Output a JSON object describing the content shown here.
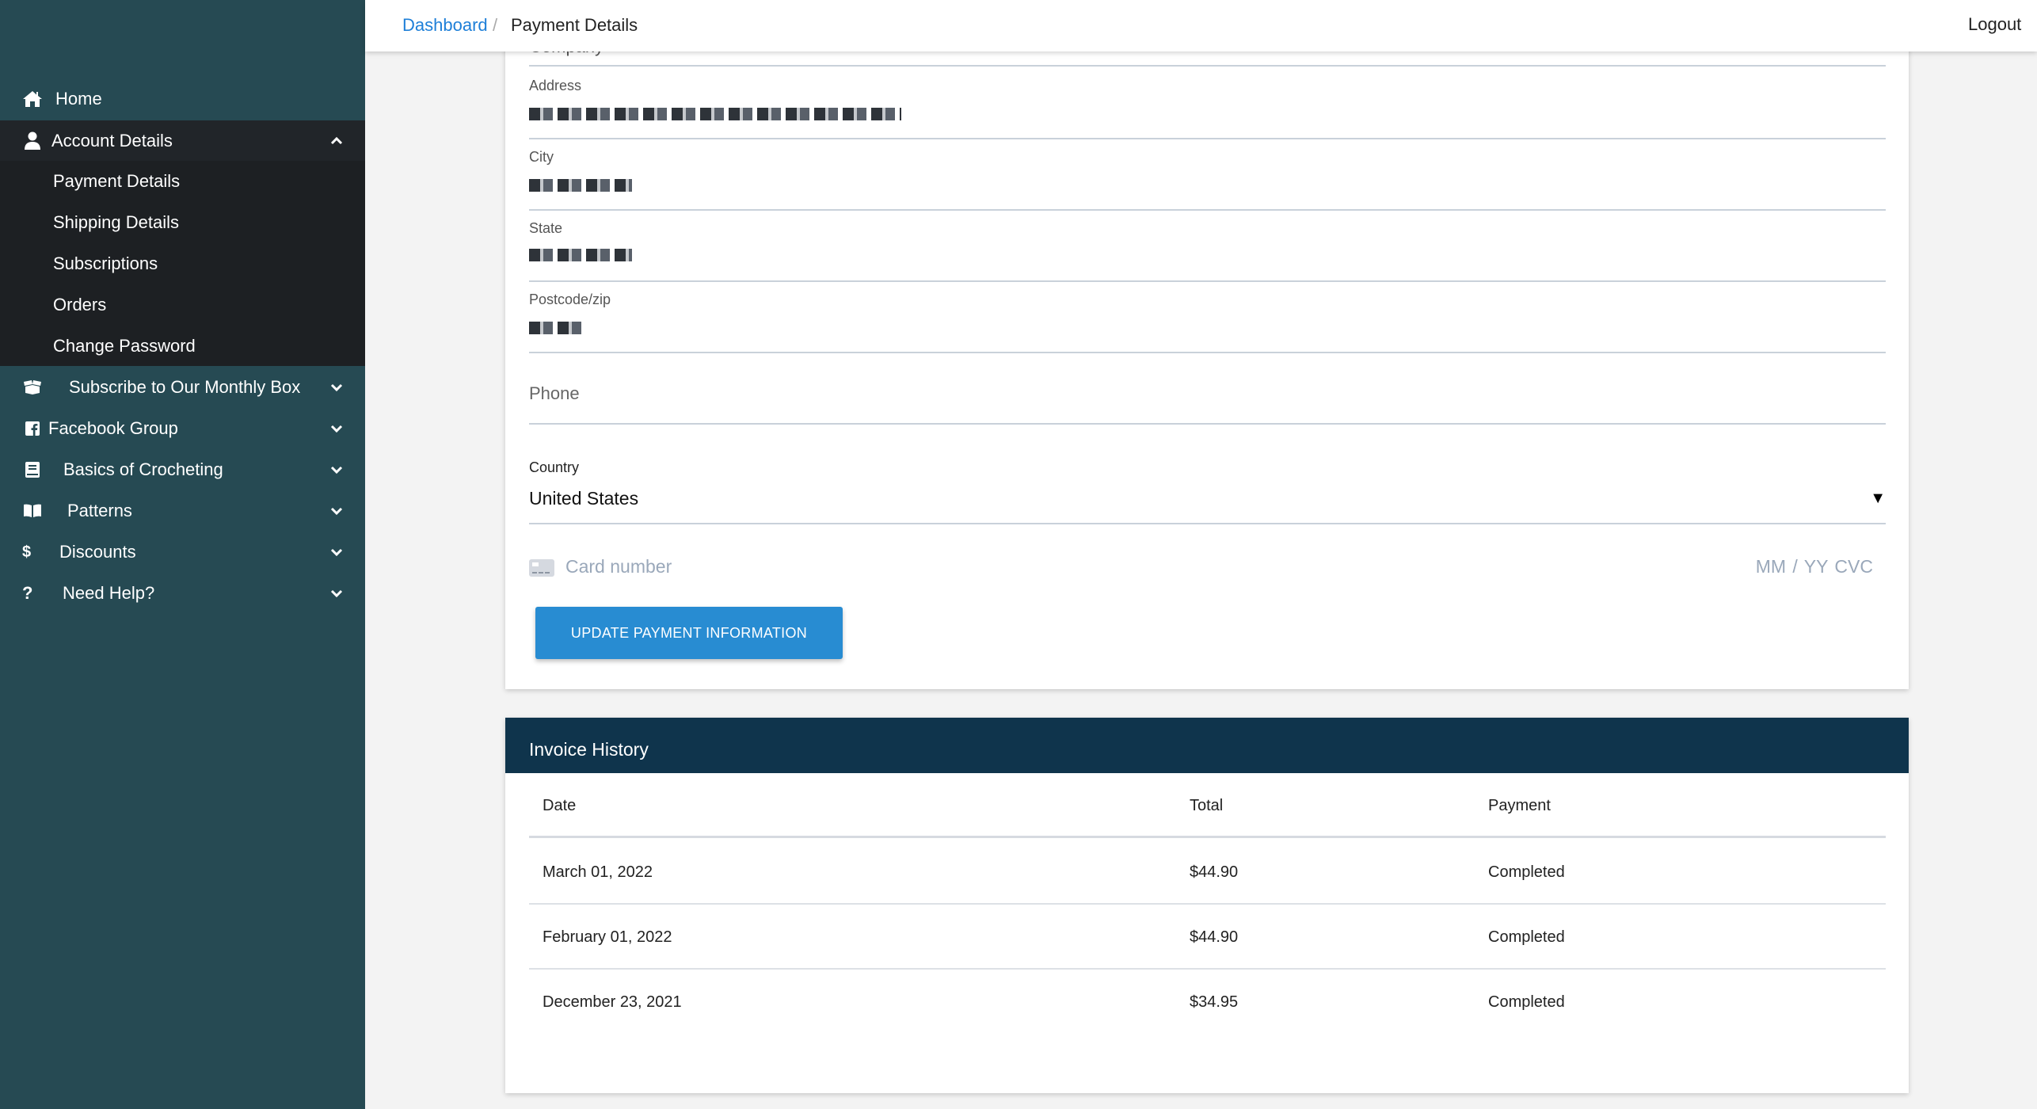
{
  "sidebar": {
    "items": [
      {
        "label": "Home",
        "icon": "home-icon"
      },
      {
        "label": "Account Details",
        "icon": "user-icon",
        "expanded": true,
        "children": [
          "Payment Details",
          "Shipping Details",
          "Subscriptions",
          "Orders",
          "Change Password"
        ]
      },
      {
        "label": "Subscribe to Our Monthly Box",
        "icon": "box-open-icon"
      },
      {
        "label": "Facebook Group",
        "icon": "facebook-icon"
      },
      {
        "label": "Basics of Crocheting",
        "icon": "book-icon"
      },
      {
        "label": "Patterns",
        "icon": "book-open-icon"
      },
      {
        "label": "Discounts",
        "icon": "dollar-icon"
      },
      {
        "label": "Need Help?",
        "icon": "question-icon"
      }
    ]
  },
  "header": {
    "breadcrumb": {
      "parent": "Dashboard",
      "separator": "/",
      "current": "Payment Details"
    },
    "logout": "Logout"
  },
  "payment_form": {
    "company_label": "Company",
    "address_label": "Address",
    "city_label": "City",
    "state_label": "State",
    "postcode_label": "Postcode/zip",
    "phone_placeholder": "Phone",
    "country_label": "Country",
    "country_value": "United States",
    "card_number_placeholder": "Card number",
    "card_expiry_cvc_placeholder": "MM / YY  CVC",
    "submit_label": "UPDATE PAYMENT INFORMATION"
  },
  "invoice_history": {
    "title": "Invoice History",
    "columns": [
      "Date",
      "Total",
      "Payment"
    ],
    "rows": [
      {
        "date": "March 01, 2022",
        "total": "$44.90",
        "payment": "Completed"
      },
      {
        "date": "February 01, 2022",
        "total": "$44.90",
        "payment": "Completed"
      },
      {
        "date": "December 23, 2021",
        "total": "$34.95",
        "payment": "Completed"
      }
    ]
  },
  "colors": {
    "sidebar_bg": "#264a53",
    "sidebar_active_bg": "#212529",
    "link": "#1e7fd8",
    "button": "#288cd2",
    "invoice_header": "#0f344c"
  }
}
